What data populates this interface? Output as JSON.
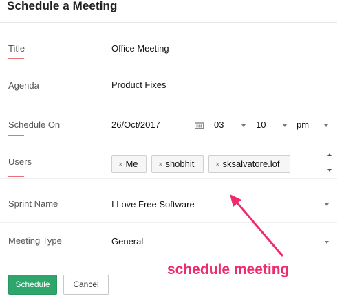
{
  "dialog": {
    "title": "Schedule a Meeting"
  },
  "form": {
    "title": {
      "label": "Title",
      "value": "Office Meeting"
    },
    "agenda": {
      "label": "Agenda",
      "value": "Product Fixes"
    },
    "schedule_on": {
      "label": "Schedule On",
      "date": "26/Oct/2017",
      "hour": "03",
      "minute": "10",
      "ampm": "pm"
    },
    "users": {
      "label": "Users",
      "chips": [
        {
          "remove": "×",
          "name": "Me"
        },
        {
          "remove": "×",
          "name": "shobhit"
        },
        {
          "remove": "×",
          "name": "sksalvatore.lof"
        }
      ]
    },
    "sprint_name": {
      "label": "Sprint Name",
      "value": "I Love Free Software"
    },
    "meeting_type": {
      "label": "Meeting Type",
      "value": "General"
    }
  },
  "actions": {
    "schedule": "Schedule",
    "cancel": "Cancel"
  },
  "annotation": {
    "text": "schedule meeting"
  },
  "colors": {
    "accent_underline": "#e8707a",
    "primary_button": "#2ea56b",
    "annotation": "#ef2b6f"
  }
}
